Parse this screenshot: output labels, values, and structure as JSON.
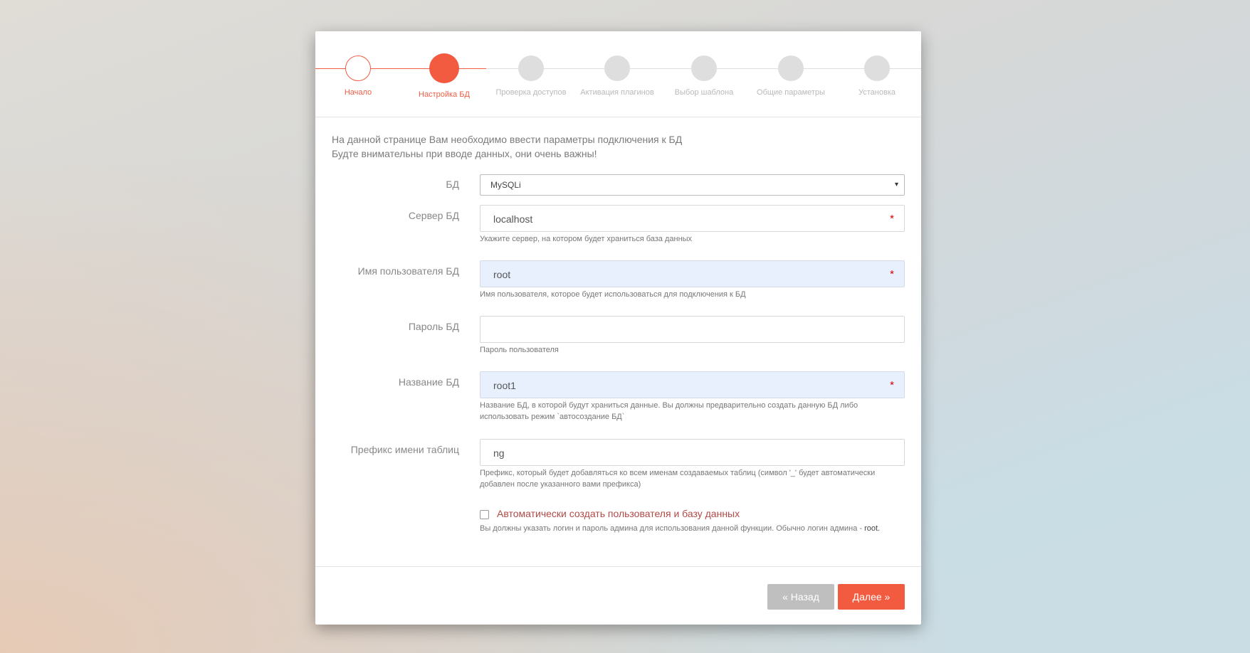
{
  "stepper": {
    "steps": [
      {
        "label": "Начало",
        "state": "done"
      },
      {
        "label": "Настройка БД",
        "state": "current"
      },
      {
        "label": "Проверка доступов",
        "state": "pending"
      },
      {
        "label": "Активация плагинов",
        "state": "pending"
      },
      {
        "label": "Выбор шаблона",
        "state": "pending"
      },
      {
        "label": "Общие параметры",
        "state": "pending"
      },
      {
        "label": "Установка",
        "state": "pending"
      }
    ]
  },
  "intro": {
    "line1": "На данной странице Вам необходимо ввести параметры подключения к БД",
    "line2": "Будте внимательны при вводе данных, они очень важны!"
  },
  "form": {
    "db_type": {
      "label": "БД",
      "value": "MySQLi",
      "caret": "▾"
    },
    "server": {
      "label": "Сервер БД",
      "value": "localhost",
      "required": "*",
      "help": "Укажите сервер, на котором будет храниться база данных"
    },
    "user": {
      "label": "Имя пользователя БД",
      "value": "root",
      "required": "*",
      "help": "Имя пользователя, которое будет использоваться для подключения к БД"
    },
    "password": {
      "label": "Пароль БД",
      "value": "",
      "help": "Пароль пользователя"
    },
    "db_name": {
      "label": "Название БД",
      "value": "root1",
      "required": "*",
      "help_line1": "Название БД, в которой будут храниться данные. Вы должны предварительно создать данную БД либо",
      "help_line2": "использовать режим `автосоздание БД`"
    },
    "prefix": {
      "label": "Префикс имени таблиц",
      "value": "ng",
      "help_line1": "Префикс, который будет добавляться ко всем именам создаваемых таблиц (символ '_' будет автоматически",
      "help_line2": "добавлен после указанного вами префикса)"
    },
    "autocreate": {
      "label": "Автоматически создать пользователя и базу данных",
      "checked": false,
      "help_text": "Вы должны указать логин и пароль админа для использования данной функции. Обычно логин админа - ",
      "help_login": "root."
    }
  },
  "footer": {
    "back_label": "« Назад",
    "next_label": "Далее »"
  },
  "colors": {
    "accent": "#f35b40",
    "pending": "#dedede",
    "button_gray": "#bfbfbf"
  }
}
